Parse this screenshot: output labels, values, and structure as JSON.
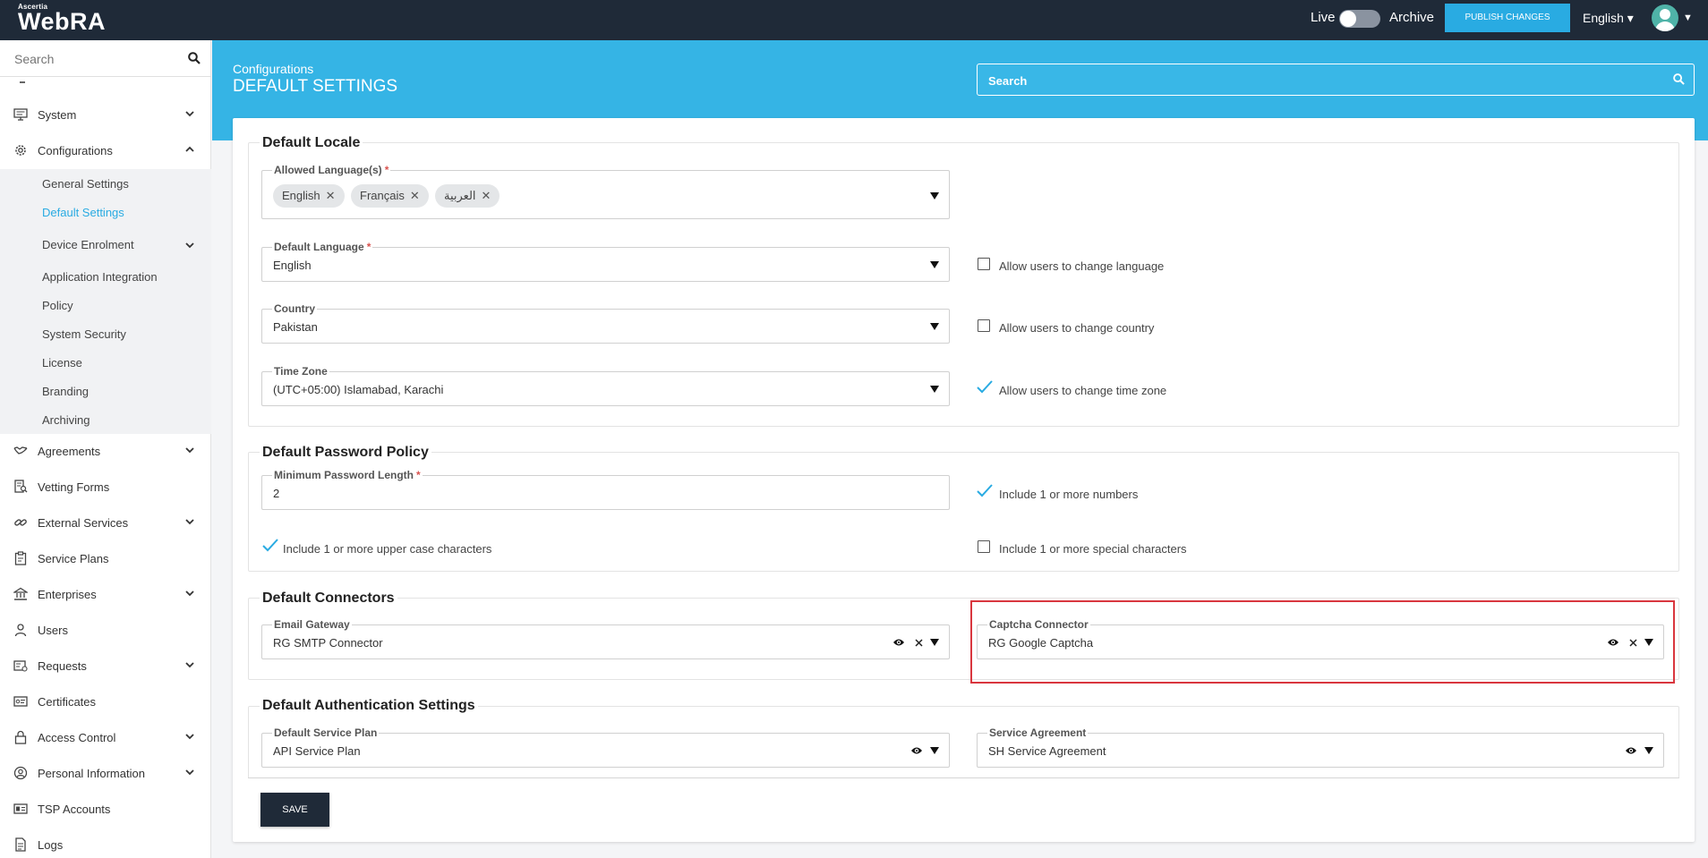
{
  "brand": {
    "small": "Ascertia",
    "name": "WebRA"
  },
  "topbar": {
    "live_label": "Live",
    "archive_label": "Archive",
    "publish_label": "PUBLISH CHANGES",
    "language": "English ▾"
  },
  "sidebar": {
    "search_placeholder": "Search",
    "items": [
      {
        "label": "System"
      },
      {
        "label": "Configurations"
      },
      {
        "label": "Agreements"
      },
      {
        "label": "Vetting Forms"
      },
      {
        "label": "External Services"
      },
      {
        "label": "Service Plans"
      },
      {
        "label": "Enterprises"
      },
      {
        "label": "Users"
      },
      {
        "label": "Requests"
      },
      {
        "label": "Certificates"
      },
      {
        "label": "Access Control"
      },
      {
        "label": "Personal Information"
      },
      {
        "label": "TSP Accounts"
      },
      {
        "label": "Logs"
      }
    ],
    "sub_items": [
      {
        "label": "General Settings"
      },
      {
        "label": "Default Settings"
      },
      {
        "label": "Device Enrolment"
      },
      {
        "label": "Application Integration"
      },
      {
        "label": "Policy"
      },
      {
        "label": "System Security"
      },
      {
        "label": "License"
      },
      {
        "label": "Branding"
      },
      {
        "label": "Archiving"
      }
    ]
  },
  "header": {
    "breadcrumb": "Configurations",
    "title": "DEFAULT SETTINGS",
    "search_placeholder": "Search"
  },
  "locale": {
    "title": "Default Locale",
    "allowed_label": "Allowed Language(s)",
    "chips": [
      "English",
      "Français",
      "العربية"
    ],
    "default_lang_label": "Default Language",
    "default_lang_value": "English",
    "allow_lang_label": "Allow users to change language",
    "allow_lang_checked": false,
    "country_label": "Country",
    "country_value": "Pakistan",
    "allow_country_label": "Allow users to change country",
    "allow_country_checked": false,
    "tz_label": "Time Zone",
    "tz_value": "(UTC+05:00) Islamabad, Karachi",
    "allow_tz_label": "Allow users to change time zone",
    "allow_tz_checked": true
  },
  "password": {
    "title": "Default Password Policy",
    "min_len_label": "Minimum Password Length",
    "min_len_value": "2",
    "numbers_label": "Include 1 or more numbers",
    "numbers_checked": true,
    "upper_label": "Include 1 or more upper case characters",
    "upper_checked": true,
    "special_label": "Include 1 or more special characters",
    "special_checked": false
  },
  "connectors": {
    "title": "Default Connectors",
    "email_label": "Email Gateway",
    "email_value": "RG SMTP Connector",
    "captcha_label": "Captcha Connector",
    "captcha_value": "RG Google Captcha"
  },
  "auth": {
    "title": "Default Authentication Settings",
    "plan_label": "Default Service Plan",
    "plan_value": "API Service Plan",
    "agreement_label": "Service Agreement",
    "agreement_value": "SH Service Agreement"
  },
  "save_label": "SAVE",
  "colors": {
    "accent": "#35b4e5",
    "topbar": "#1f2a38",
    "highlight": "#d9363e",
    "check": "#29abe2"
  }
}
